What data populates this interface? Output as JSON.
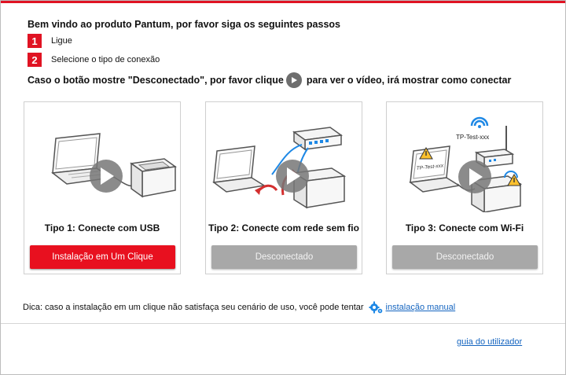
{
  "colors": {
    "accent": "#e01323",
    "button_active": "#e8101f",
    "button_disabled": "#a8a8a8",
    "link": "#1565c0"
  },
  "header": {
    "title": "Bem vindo ao produto Pantum, por favor siga os seguintes passos"
  },
  "steps": [
    {
      "number": "1",
      "text": "Ligue"
    },
    {
      "number": "2",
      "text": "Selecione o tipo de conexão"
    }
  ],
  "video_hint": {
    "before": "Caso o botão mostre \"Desconectado\", por favor clique",
    "icon": "play-icon",
    "after": "para ver o vídeo, irá mostrar como conectar"
  },
  "cards": [
    {
      "title": "Tipo 1: Conecte com USB",
      "button": "Instalação em Um Clique",
      "state": "active"
    },
    {
      "title": "Tipo 2: Conecte com rede sem fio",
      "button": "Desconectado",
      "state": "disabled"
    },
    {
      "title": "Tipo 3: Conecte com Wi-Fi",
      "button": "Desconectado",
      "state": "disabled",
      "ssid_label": "TP-Test-xxx"
    }
  ],
  "tip": {
    "text": "Dica: caso a instalação em um clique não satisfaça seu cenário de uso, você pode tentar",
    "icon": "gear-icon",
    "link": "instalação manual"
  },
  "footer": {
    "guide_link": "guia do utilizador"
  }
}
